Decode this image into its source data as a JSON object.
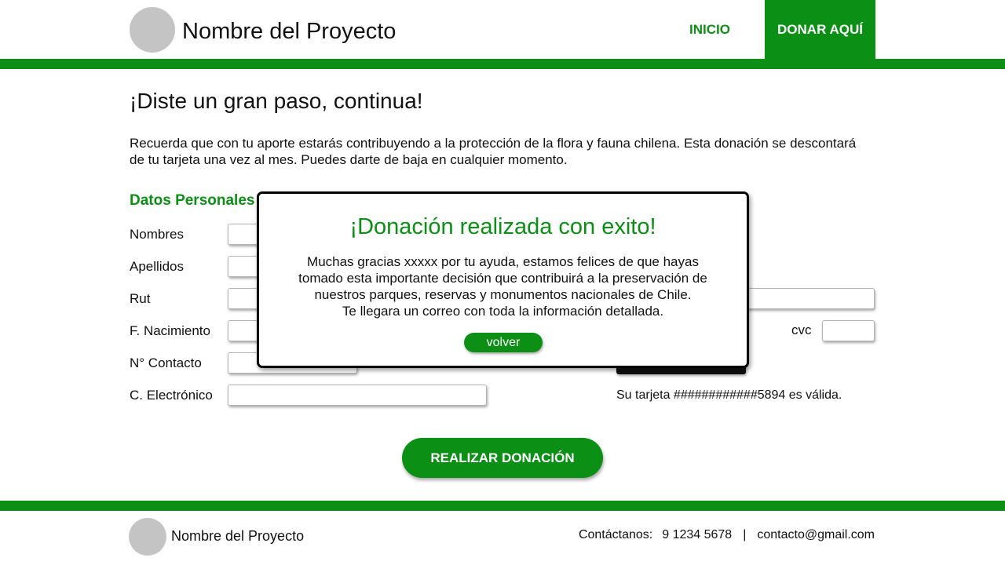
{
  "header": {
    "brand": "Nombre del Proyecto",
    "nav_inicio": "INICIO",
    "nav_donar": "DONAR AQUÍ"
  },
  "main": {
    "title": "¡Diste un gran paso, continua!",
    "intro": "Recuerda que con tu aporte estarás contribuyendo a la protección de la flora y fauna chilena. Esta donación se descontará de tu tarjeta una vez al mes. Puedes darte de baja en cualquier momento.",
    "section_title": "Datos Personales",
    "fields": {
      "nombres": "Nombres",
      "apellidos": "Apellidos",
      "rut": "Rut",
      "nacimiento": "F. Nacimiento",
      "contacto": "N° Contacto",
      "email": "C. Electrónico"
    },
    "cvc_label": "cvc",
    "card_status": "Su tarjeta ############5894 es válida.",
    "donate_button": "REALIZAR DONACIÓN"
  },
  "footer": {
    "brand": "Nombre del Proyecto",
    "contact_label": "Contáctanos:",
    "phone": "9 1234 5678",
    "separator": "|",
    "email": "contacto@gmail.com"
  },
  "modal": {
    "title": "¡Donación realizada con exito!",
    "line1": "Muchas gracias xxxxx por tu ayuda, estamos felices de que hayas",
    "line2": "tomado esta importante decisión que contribuirá a la preservación de",
    "line3": "nuestros parques, reservas y monumentos nacionales de Chile.",
    "line4": "Te llegara un correo con toda la información detallada.",
    "button": "volver"
  },
  "colors": {
    "accent": "#0b8f15",
    "placeholder_logo": "#c4c4c4"
  }
}
